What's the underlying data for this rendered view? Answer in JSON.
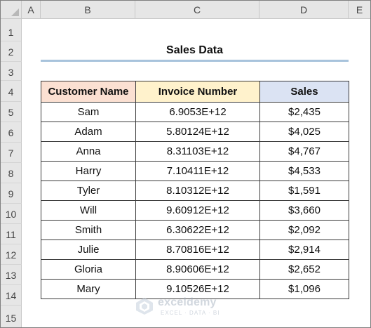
{
  "columns": [
    "A",
    "B",
    "C",
    "D",
    "E"
  ],
  "rows": [
    "1",
    "2",
    "3",
    "4",
    "5",
    "6",
    "7",
    "8",
    "9",
    "10",
    "11",
    "12",
    "13",
    "14",
    "15"
  ],
  "title": "Sales Data",
  "table": {
    "headers": {
      "name": "Customer Name",
      "invoice": "Invoice Number",
      "sales": "Sales"
    },
    "header_colors": {
      "name": "#fbe0d2",
      "invoice": "#fff2cc",
      "sales": "#dbe3f3"
    },
    "records": [
      {
        "name": "Sam",
        "invoice": "6.9053E+12",
        "sales": "$2,435"
      },
      {
        "name": "Adam",
        "invoice": "5.80124E+12",
        "sales": "$4,025"
      },
      {
        "name": "Anna",
        "invoice": "8.31103E+12",
        "sales": "$4,767"
      },
      {
        "name": "Harry",
        "invoice": "7.10411E+12",
        "sales": "$4,533"
      },
      {
        "name": "Tyler",
        "invoice": "8.10312E+12",
        "sales": "$1,591"
      },
      {
        "name": "Will",
        "invoice": "9.60912E+12",
        "sales": "$3,660"
      },
      {
        "name": "Smith",
        "invoice": "6.30622E+12",
        "sales": "$2,092"
      },
      {
        "name": "Julie",
        "invoice": "8.70816E+12",
        "sales": "$2,914"
      },
      {
        "name": "Gloria",
        "invoice": "8.90606E+12",
        "sales": "$2,652"
      },
      {
        "name": "Mary",
        "invoice": "9.10526E+12",
        "sales": "$1,096"
      }
    ]
  },
  "watermark": {
    "name": "exceldemy",
    "tagline": "EXCEL · DATA · BI"
  },
  "colors": {
    "title_underline": "#a8c3dc",
    "header_bar": "#e6e6e6"
  }
}
